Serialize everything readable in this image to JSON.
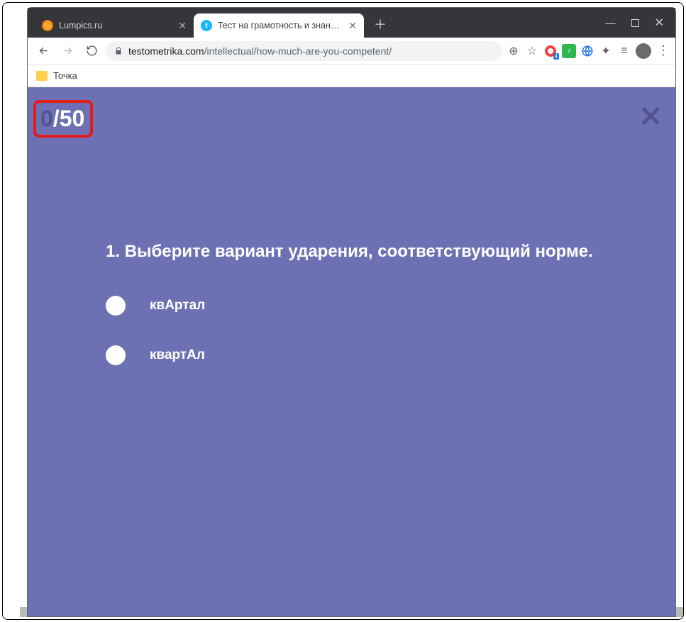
{
  "window": {
    "tabs": [
      {
        "title": "Lumpics.ru",
        "active": false
      },
      {
        "title": "Тест на грамотность и знание р",
        "active": true,
        "favicon_letter": "t"
      }
    ],
    "url_host": "testometrika.com",
    "url_path": "/intellectual/how-much-are-you-competent/",
    "opera_badge": "4"
  },
  "bookmarks": {
    "item1": "Точка"
  },
  "quiz": {
    "current": "0",
    "separator": "/",
    "total": "50",
    "question_number": "1.",
    "question_text": "Выберите вариант ударения, соответствующий норме.",
    "options": [
      {
        "label": "квАртал"
      },
      {
        "label": "квартАл"
      }
    ]
  },
  "glyphs": {
    "plus": "＋",
    "close": "✕",
    "zoom": "⊕",
    "star": "☆",
    "puzzle": "✦",
    "tune": "≡",
    "dots": "⋮",
    "note": "♪"
  }
}
